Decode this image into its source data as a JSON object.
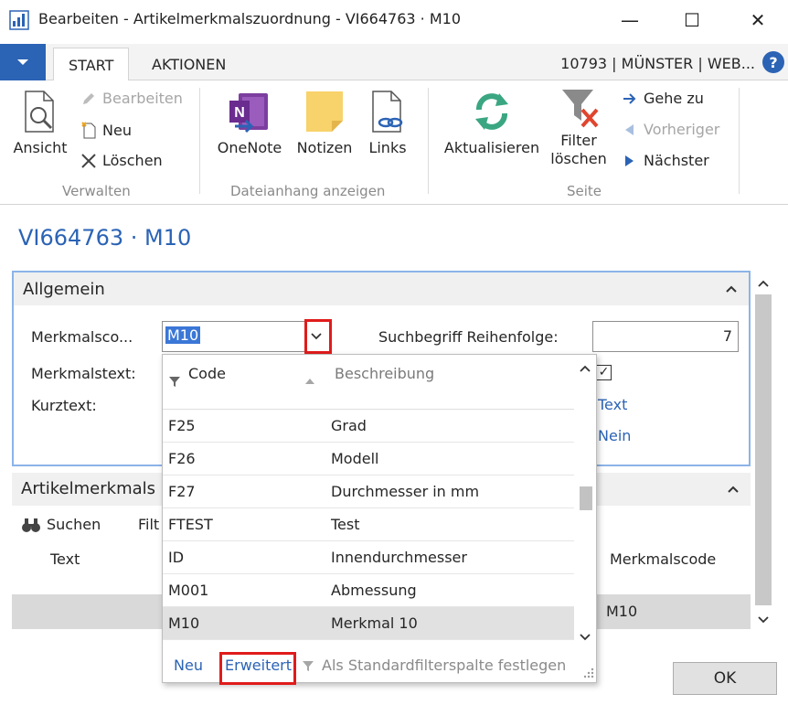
{
  "window": {
    "title": "Bearbeiten - Artikelmerkmalszuordnung - VI664763 · M10",
    "minimize": "—",
    "maximize": "☐",
    "close": "✕"
  },
  "ribbon_tabs": {
    "start": "START",
    "aktionen": "AKTIONEN",
    "company": "10793 | MÜNSTER | WEB...",
    "help": "?"
  },
  "ribbon": {
    "verwalten": {
      "label": "Verwalten",
      "ansicht": "Ansicht",
      "bearbeiten": "Bearbeiten",
      "neu": "Neu",
      "loeschen": "Löschen"
    },
    "dateianhang": {
      "label": "Dateianhang anzeigen",
      "onenote": "OneNote",
      "notizen": "Notizen",
      "links": "Links"
    },
    "seite": {
      "label": "Seite",
      "aktualisieren": "Aktualisieren",
      "filter_loeschen_1": "Filter",
      "filter_loeschen_2": "löschen",
      "gehe_zu": "Gehe zu",
      "vorheriger": "Vorheriger",
      "naechster": "Nächster"
    }
  },
  "page_title": "VI664763 · M10",
  "allgemein": {
    "title": "Allgemein",
    "merkmalscode_label": "Merkmalsco...",
    "merkmalscode_value": "M10",
    "merkmalstext_label": "Merkmalstext:",
    "kurztext_label": "Kurztext:",
    "suchbegriff_label": "Suchbegriff Reihenfolge:",
    "suchbegriff_value": "7",
    "checkbox_mark": "✓",
    "typ_value": "Text",
    "flag_value": "Nein"
  },
  "lines": {
    "title": "Artikelmerkmals",
    "suchen": "Suchen",
    "filter_trunc": "Filt",
    "col_text": "Text",
    "col_merkmalscode": "Merkmalscode",
    "row_merkmalscode": "M10"
  },
  "dropdown": {
    "col_code": "Code",
    "col_beschreibung": "Beschreibung",
    "rows": [
      {
        "code": "F25",
        "desc": "Grad"
      },
      {
        "code": "F26",
        "desc": "Modell"
      },
      {
        "code": "F27",
        "desc": "Durchmesser in mm"
      },
      {
        "code": "FTEST",
        "desc": "Test"
      },
      {
        "code": "ID",
        "desc": "Innendurchmesser"
      },
      {
        "code": "M001",
        "desc": "Abmessung"
      },
      {
        "code": "M10",
        "desc": "Merkmal 10"
      }
    ],
    "footer_neu": "Neu",
    "footer_erweitert": "Erweitert",
    "footer_standardfilter": "Als Standardfilterspalte festlegen"
  },
  "ok_button": "OK",
  "colors": {
    "accent": "#2b63b5",
    "highlight_border": "#e01b1b",
    "selection": "#3b77d6"
  }
}
